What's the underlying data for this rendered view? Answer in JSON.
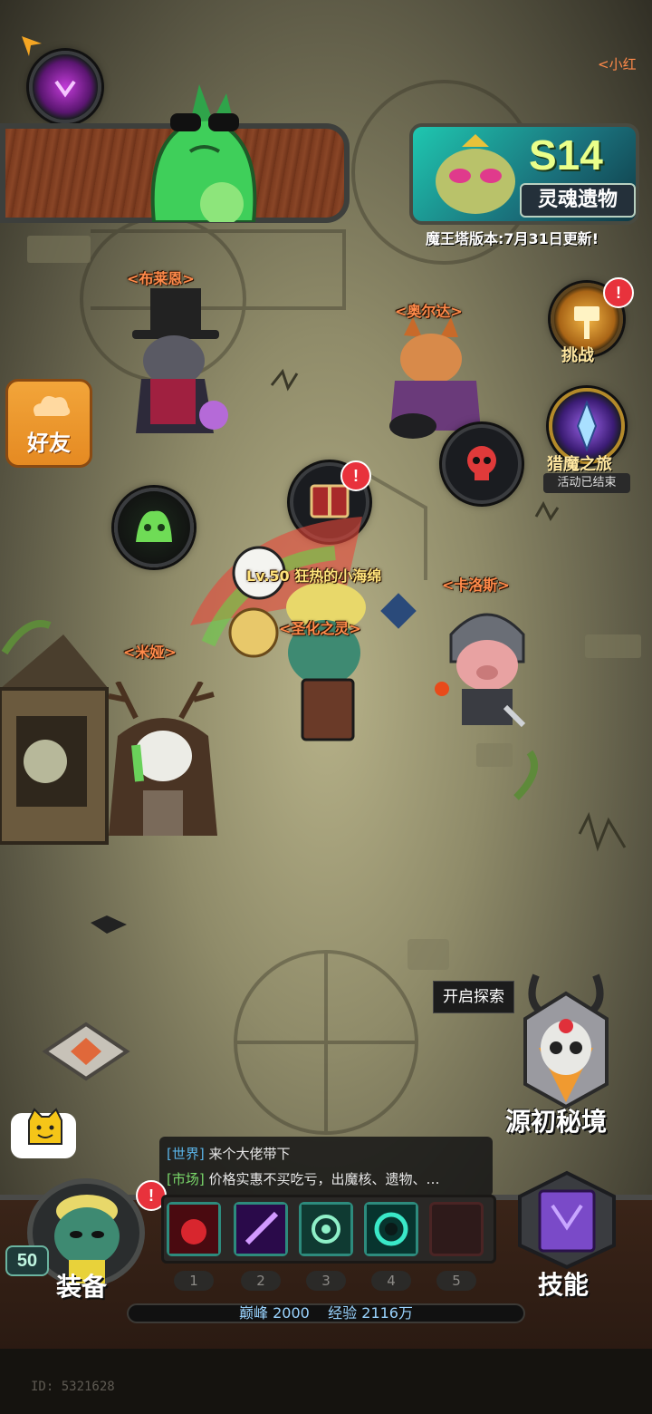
{
  "season_banner": {
    "season": "S14",
    "subtitle": "灵魂遗物",
    "version_note": "魔王塔版本:7月31日更新!"
  },
  "top_right_partial": "<小红",
  "buttons": {
    "challenge": "挑战",
    "hunt_journey": "猎魔之旅",
    "hunt_journey_status": "活动已结束",
    "friends": "好友",
    "explore_tooltip": "开启探索",
    "origin_realm": "源初秘境",
    "equipment": "装备",
    "skills": "技能"
  },
  "npcs": {
    "npc1": "<布莱恩>",
    "npc2": "<奥尔达>",
    "npc3": "<卡洛斯>",
    "npc4": "<米娅>",
    "pet": "<圣化之灵>"
  },
  "player": {
    "title": "Lv.50 狂热的小海绵",
    "level": "50",
    "id": "ID: 5321628"
  },
  "chat": [
    {
      "channel": "[世界]",
      "text": "来个大佬带下"
    },
    {
      "channel": "[市场]",
      "text": "价格实惠不买吃亏，出魔核、遗物、…"
    }
  ],
  "skill_slots": [
    "1",
    "2",
    "3",
    "4",
    "5"
  ],
  "progress": {
    "peak_label": "巅峰",
    "peak_value": "2000",
    "exp_label": "经验",
    "exp_value": "2116万"
  },
  "badge_mark": "!",
  "colors": {
    "accent_orange": "#f09a30",
    "npc_label": "#ff8a4a",
    "player_label": "#ffe37a",
    "teal": "#2d8b7d",
    "alert_red": "#e8323c"
  }
}
